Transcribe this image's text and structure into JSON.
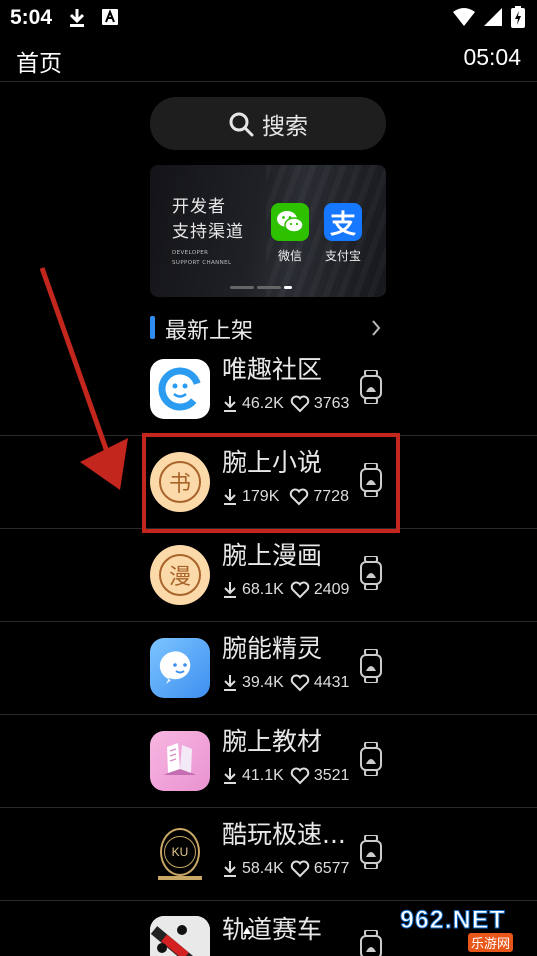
{
  "status_bar": {
    "time": "5:04"
  },
  "header": {
    "title": "首页",
    "clock": "05:04"
  },
  "search": {
    "label": "搜索"
  },
  "banner": {
    "line1": "开发者",
    "line2": "支持渠道",
    "en_line1": "DEVELOPER",
    "en_line2": "SUPPORT CHANNEL",
    "wechat_label": "微信",
    "alipay_label": "支付宝",
    "alipay_glyph": "支",
    "wechat_color": "#2dc100",
    "alipay_color": "#1677ff"
  },
  "section": {
    "title": "最新上架"
  },
  "apps": [
    {
      "name": "唯趣社区",
      "downloads": "46.2K",
      "likes": "3763",
      "icon": "weiqu-community-icon"
    },
    {
      "name": "腕上小说",
      "downloads": "179K",
      "likes": "7728",
      "icon": "wrist-novel-icon",
      "glyph": "书"
    },
    {
      "name": "腕上漫画",
      "downloads": "68.1K",
      "likes": "2409",
      "icon": "wrist-comic-icon",
      "glyph": "漫"
    },
    {
      "name": "腕能精灵",
      "downloads": "39.4K",
      "likes": "4431",
      "icon": "wrist-sprite-icon"
    },
    {
      "name": "腕上教材",
      "downloads": "41.1K",
      "likes": "3521",
      "icon": "wrist-textbook-icon"
    },
    {
      "name": "酷玩极速...",
      "downloads": "58.4K",
      "likes": "6577",
      "icon": "kuwan-speed-icon",
      "glyph": "KU"
    },
    {
      "name": "轨道赛车",
      "icon": "track-racing-icon"
    }
  ],
  "watermark": {
    "big": "962.NET",
    "small": "乐游网"
  },
  "colors": {
    "accent": "#2f8cf0",
    "highlight": "#c2261d",
    "background": "#000000"
  }
}
